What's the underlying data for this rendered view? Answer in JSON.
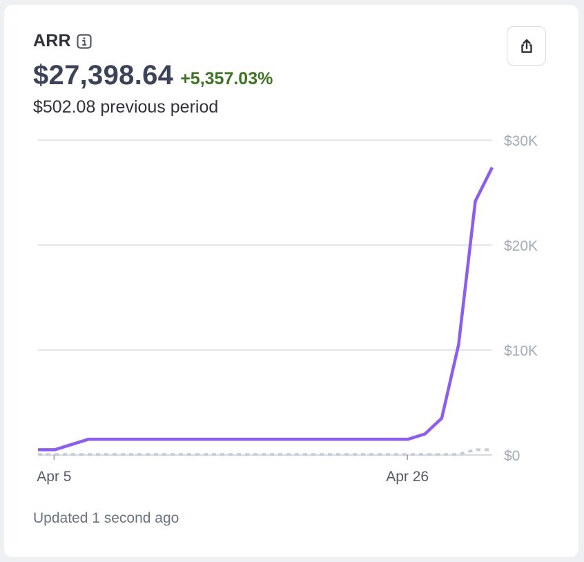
{
  "card": {
    "title": "ARR",
    "info_icon": "info-icon",
    "value": "$27,398.64",
    "change": "+5,357.03%",
    "previous": "$502.08 previous period",
    "export_icon": "share-export-icon",
    "footer": "Updated 1 second ago"
  },
  "colors": {
    "current_series": "#8b5cf6",
    "previous_series": "#c7cdd6",
    "change_positive": "#3b7522",
    "gridline": "#d8dee4"
  },
  "chart_data": {
    "type": "line",
    "x_ticks": [
      "Apr 5",
      "Apr 26"
    ],
    "y_ticks": [
      "$0",
      "$10K",
      "$20K",
      "$30K"
    ],
    "ylim": [
      0,
      30000
    ],
    "grid": true,
    "series": [
      {
        "style": "solid",
        "x_day": [
          4,
          5,
          6,
          7,
          8,
          9,
          10,
          11,
          12,
          13,
          14,
          15,
          16,
          17,
          18,
          19,
          20,
          21,
          22,
          23,
          24,
          25,
          26,
          27,
          28,
          29,
          30
        ],
        "values": [
          502,
          502,
          1000,
          1500,
          1500,
          1500,
          1500,
          1500,
          1500,
          1500,
          1500,
          1500,
          1500,
          1500,
          1500,
          1500,
          1500,
          1500,
          1500,
          1500,
          1500,
          1500,
          1500,
          2000,
          3500,
          10500,
          24200
        ]
      },
      {
        "style": "dotted",
        "x_day": [
          4,
          26,
          27,
          28,
          29,
          30,
          31
        ],
        "values": [
          50,
          50,
          50,
          50,
          50,
          500,
          500
        ]
      }
    ],
    "current_endpoint": {
      "x_day": 31,
      "value": 27398.64
    }
  }
}
